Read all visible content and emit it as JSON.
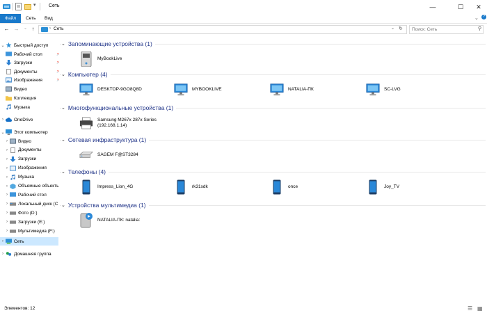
{
  "window": {
    "title": "Сеть",
    "controls": [
      "minimize",
      "maximize",
      "close"
    ]
  },
  "ribbon": {
    "tabs": [
      {
        "label": "Файл",
        "active": true
      },
      {
        "label": "Сеть",
        "active": false
      },
      {
        "label": "Вид",
        "active": false
      }
    ]
  },
  "address": {
    "path": "Сеть",
    "search_placeholder": "Поиск: Сеть"
  },
  "nav": {
    "quick_access": "Быстрый доступ",
    "quick_items": [
      {
        "label": "Рабочий стол",
        "pinned": true
      },
      {
        "label": "Загрузки",
        "pinned": true
      },
      {
        "label": "Документы",
        "pinned": true
      },
      {
        "label": "Изображения",
        "pinned": true
      },
      {
        "label": "Видео"
      },
      {
        "label": "Коллекция"
      },
      {
        "label": "Музыка"
      }
    ],
    "onedrive": "OneDrive",
    "this_pc": "Этот компьютер",
    "pc_items": [
      "Видео",
      "Документы",
      "Загрузки",
      "Изображения",
      "Музыка",
      "Объемные объекты",
      "Рабочий стол",
      "Локальный диск (C",
      "Фото (D:)",
      "Загрузки (E:)",
      "Мультимедиа (F:)"
    ],
    "network": "Сеть",
    "homegroup": "Домашняя группа"
  },
  "groups": [
    {
      "title": "Запоминающие устройства (1)",
      "items": [
        {
          "label": "MyBookLive",
          "icon": "nas-drive-icon"
        }
      ]
    },
    {
      "title": "Компьютер (4)",
      "items": [
        {
          "label": "DESKTOP-9GO8Q8D",
          "icon": "monitor-icon"
        },
        {
          "label": "MYBOOKLIVE",
          "icon": "monitor-icon"
        },
        {
          "label": "NATALIA-ПК",
          "icon": "monitor-icon"
        },
        {
          "label": "SC-LVG",
          "icon": "monitor-icon"
        }
      ]
    },
    {
      "title": "Многофункциональные устройства (1)",
      "items": [
        {
          "label": "Samsung M267x 287x Series",
          "label2": "(192.168.1.14)",
          "icon": "printer-icon"
        }
      ]
    },
    {
      "title": "Сетевая инфраструктура (1)",
      "items": [
        {
          "label": "SAGEM F@ST3284",
          "icon": "router-icon"
        }
      ]
    },
    {
      "title": "Телефоны (4)",
      "items": [
        {
          "label": "Impress_Lion_4G",
          "icon": "phone-icon"
        },
        {
          "label": "rk31sdk",
          "icon": "phone-icon"
        },
        {
          "label": "once",
          "icon": "phone-icon"
        },
        {
          "label": "Joy_TV",
          "icon": "phone-icon"
        }
      ]
    },
    {
      "title": "Устройства мультимедиа (1)",
      "items": [
        {
          "label": "NATALIA-ПК: natalia:",
          "icon": "media-server-icon"
        }
      ]
    }
  ],
  "status": {
    "count": "Элементов: 12"
  },
  "colors": {
    "accent": "#1979ca",
    "group_title": "#1e3287",
    "selection": "#cce8ff"
  }
}
